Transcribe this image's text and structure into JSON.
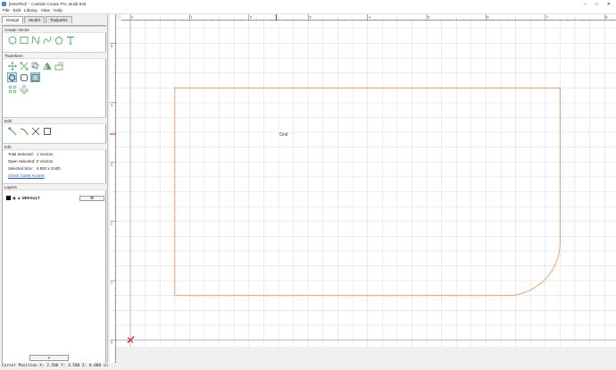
{
  "window": {
    "title": "[NewFile]* - Carbide Create Pro, Build 845",
    "controls": {
      "minimize": "–",
      "maximize": "□",
      "close": "✕"
    }
  },
  "menu": [
    "File",
    "Edit",
    "Library",
    "View",
    "Help"
  ],
  "tabs": [
    "Design",
    "Model",
    "Toolpaths"
  ],
  "sections": {
    "create_vector": "Create Vector",
    "transform": "Transform",
    "edit": "Edit",
    "info": "Info",
    "layers": "Layers"
  },
  "info": {
    "total_selected_label": "Total Selected:",
    "total_selected_value": "1 Vectors",
    "open_selected_label": "Open Selected:",
    "open_selected_value": "0 Vectors",
    "selected_size_label": "Selected Size:",
    "selected_size_value": "6.500 x 3.500",
    "check_cutter_link": "Check Cutter Access"
  },
  "layers": {
    "items": [
      {
        "name": "DEFAULT",
        "color": "#000000"
      }
    ],
    "add_label": "+"
  },
  "canvas": {
    "ruler_x_labels": [
      "0",
      "1",
      "2",
      "3",
      "4",
      "5",
      "6",
      "7",
      "8"
    ],
    "ruler_y_labels": [
      "5",
      "4",
      "3",
      "2",
      "1",
      "0"
    ],
    "grid_label": "Grid",
    "shape_color": "#e46b1f",
    "grid_color": "#d9d9d9",
    "origin_color": "#e02020"
  },
  "status": {
    "text": "Cursor Position X: 2.580 Y: 3.580 Z: 0.000 in"
  },
  "icons": [
    "circle-icon",
    "rectangle-icon",
    "polyline-icon",
    "curve-icon",
    "polygon-icon",
    "text-icon"
  ]
}
